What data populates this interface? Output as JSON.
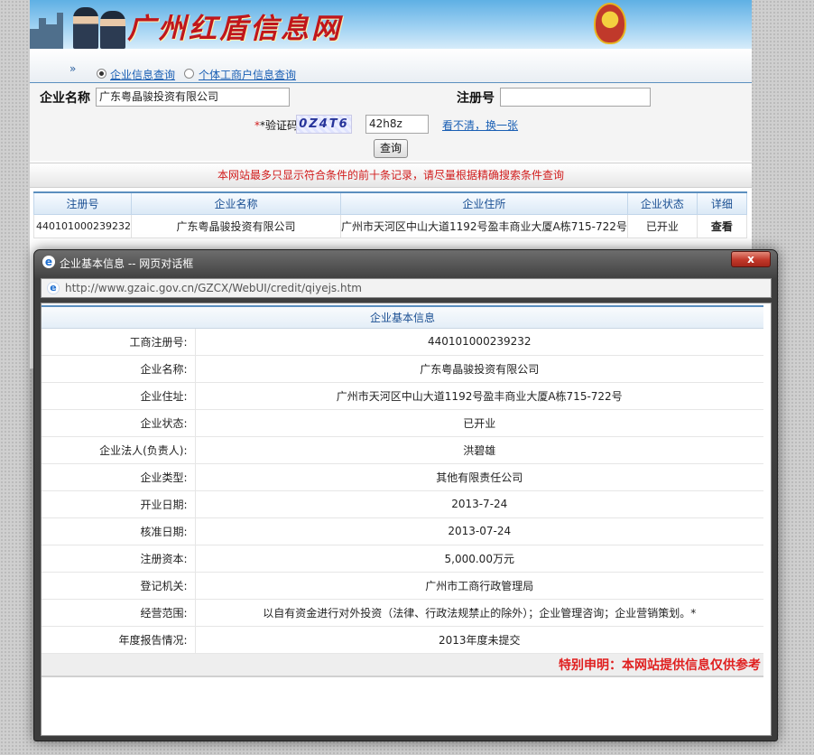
{
  "site": {
    "title": "广州红盾信息网"
  },
  "nav": {
    "options": [
      {
        "label": "企业信息查询",
        "selected": true
      },
      {
        "label": "个体工商户信息查询",
        "selected": false
      }
    ]
  },
  "search": {
    "company_name_label": "企业名称",
    "company_name_value": "广东粤晶骏投资有限公司",
    "reg_no_label": "注册号",
    "reg_no_value": "",
    "captcha_label": "*验证码",
    "captcha_image_text": "0Z4T6",
    "captcha_value": "42h8z",
    "captcha_refresh": "看不清，换一张",
    "query_button": "查询"
  },
  "notice": "本网站最多只显示符合条件的前十条记录，请尽量根据精确搜索条件查询",
  "results": {
    "headers": [
      "注册号",
      "企业名称",
      "企业住所",
      "企业状态",
      "详细"
    ],
    "rows": [
      [
        "440101000239232",
        "广东粤晶骏投资有限公司",
        "广州市天河区中山大道1192号盈丰商业大厦A栋715-722号",
        "已开业",
        "查看"
      ]
    ]
  },
  "dialog": {
    "title": "企业基本信息 -- 网页对话框",
    "close_label": "x",
    "url": "http://www.gzaic.gov.cn/GZCX/WebUI/credit/qiyejs.htm",
    "caption": "企业基本信息",
    "fields": [
      {
        "label": "工商注册号:",
        "value": "440101000239232"
      },
      {
        "label": "企业名称:",
        "value": "广东粤晶骏投资有限公司"
      },
      {
        "label": "企业住址:",
        "value": "广州市天河区中山大道1192号盈丰商业大厦A栋715-722号"
      },
      {
        "label": "企业状态:",
        "value": "已开业"
      },
      {
        "label": "企业法人(负责人):",
        "value": "洪碧雄"
      },
      {
        "label": "企业类型:",
        "value": "其他有限责任公司"
      },
      {
        "label": "开业日期:",
        "value": "2013-7-24"
      },
      {
        "label": "核准日期:",
        "value": "2013-07-24"
      },
      {
        "label": "注册资本:",
        "value": "5,000.00万元"
      },
      {
        "label": "登记机关:",
        "value": "广州市工商行政管理局"
      },
      {
        "label": "经营范围:",
        "value": "以自有资金进行对外投资（法律、行政法规禁止的除外）；企业管理咨询；企业营销策划。*"
      },
      {
        "label": "年度报告情况:",
        "value": "2013年度未提交"
      }
    ],
    "disclaimer": "特别申明：本网站提供信息仅供参考"
  }
}
